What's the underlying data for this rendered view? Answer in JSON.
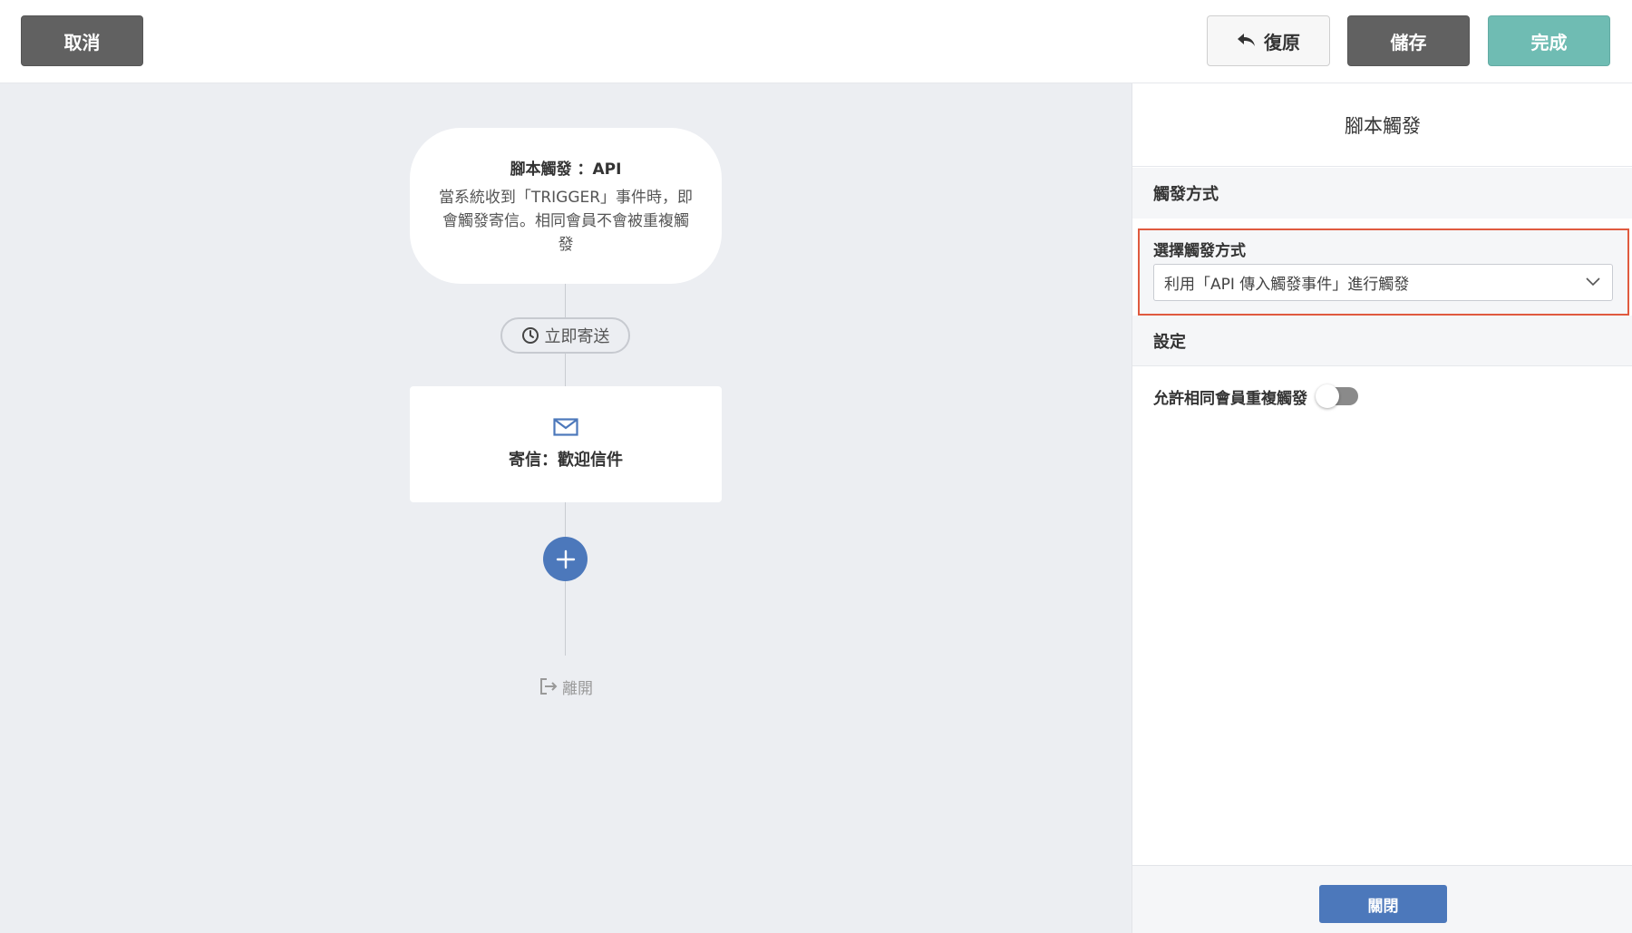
{
  "toolbar": {
    "cancel_label": "取消",
    "undo_label": "復原",
    "save_label": "儲存",
    "done_label": "完成"
  },
  "canvas": {
    "trigger_node": {
      "title": "腳本觸發 ：API",
      "description": "當系統收到「TRIGGER」事件時，即會觸發寄信。相同會員不會被重複觸發"
    },
    "delay_label": "立即寄送",
    "email_node": {
      "label": "寄信：歡迎信件"
    },
    "exit_label": "離開"
  },
  "panel": {
    "title": "腳本觸發",
    "trigger_section": "觸發方式",
    "trigger_field_label": "選擇觸發方式",
    "trigger_selected": "利用「API 傳入觸發事件」進行觸發",
    "settings_section": "設定",
    "allow_repeat_label": "允許相同會員重複觸發",
    "allow_repeat_on": false,
    "close_label": "關閉"
  },
  "colors": {
    "primary_blue": "#4c78bb",
    "done_teal": "#6fbcb3",
    "dark_button": "#616161",
    "highlight_red": "#e05a3f",
    "canvas_bg": "#eceef2"
  },
  "icons": {
    "undo": "undo-arrow-icon",
    "clock": "clock-icon",
    "mail": "mail-icon",
    "plus": "plus-icon",
    "exit": "exit-icon",
    "chevron": "chevron-down-icon"
  }
}
